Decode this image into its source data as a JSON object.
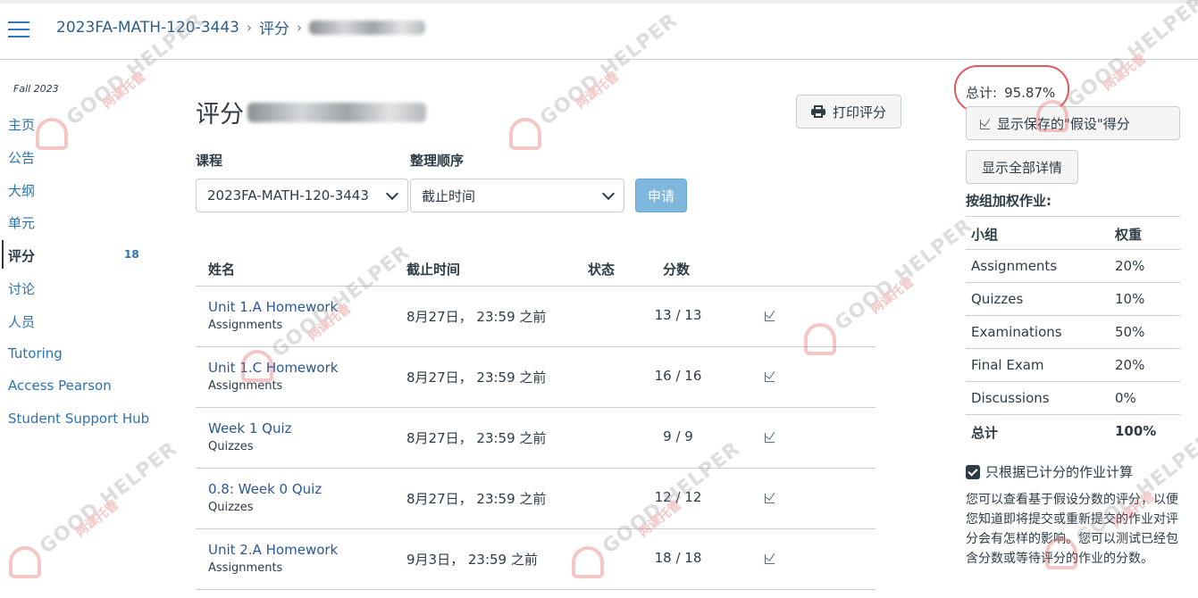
{
  "breadcrumb": {
    "course": "2023FA-MATH-120-3443",
    "grades": "评分",
    "separator": "›"
  },
  "nav": {
    "term": "Fall 2023",
    "items": [
      {
        "label": "主页"
      },
      {
        "label": "公告"
      },
      {
        "label": "大纲"
      },
      {
        "label": "单元"
      },
      {
        "label": "评分",
        "badge": "18",
        "active": true
      },
      {
        "label": "讨论"
      },
      {
        "label": "人员"
      },
      {
        "label": "Tutoring"
      },
      {
        "label": "Access Pearson"
      },
      {
        "label": "Student Support Hub"
      }
    ]
  },
  "main": {
    "title": "评分",
    "print_label": "打印评分",
    "course_label": "课程",
    "course_value": "2023FA-MATH-120-3443",
    "sort_label": "整理顺序",
    "sort_value": "截止时间",
    "apply_label": "申请",
    "columns": {
      "name": "姓名",
      "due": "截止时间",
      "status": "状态",
      "score": "分数"
    },
    "rows": [
      {
        "name": "Unit 1.A Homework",
        "group": "Assignments",
        "due": "8月27日， 23:59 之前",
        "score": "13 / 13"
      },
      {
        "name": "Unit 1.C Homework",
        "group": "Assignments",
        "due": "8月27日， 23:59 之前",
        "score": "16 / 16"
      },
      {
        "name": "Week 1 Quiz",
        "group": "Quizzes",
        "due": "8月27日， 23:59 之前",
        "score": "9 / 9"
      },
      {
        "name": "0.8: Week 0 Quiz",
        "group": "Quizzes",
        "due": "8月27日， 23:59 之前",
        "score": "12 / 12"
      },
      {
        "name": "Unit 2.A Homework",
        "group": "Assignments",
        "due": "9月3日， 23:59 之前",
        "score": "18 / 18"
      }
    ]
  },
  "side": {
    "total_label": "总计:",
    "total_value": "95.87%",
    "whatif_label": "显示保存的\"假设\"得分",
    "details_label": "显示全部详情",
    "weights_title": "按组加权作业:",
    "weights_header": {
      "group": "小组",
      "weight": "权重"
    },
    "weights": [
      {
        "group": "Assignments",
        "weight": "20%"
      },
      {
        "group": "Quizzes",
        "weight": "10%"
      },
      {
        "group": "Examinations",
        "weight": "50%"
      },
      {
        "group": "Final Exam",
        "weight": "20%"
      },
      {
        "group": "Discussions",
        "weight": "0%"
      }
    ],
    "weights_total": {
      "group": "总计",
      "weight": "100%"
    },
    "checkbox_label": "只根据已计分的作业计算",
    "hint": "您可以查看基于假设分数的评分，以便您知道即将提交或重新提交的作业对评分会有怎样的影响。您可以测试已经包含分数或等待评分的作业的分数。"
  },
  "watermark": {
    "text": "GOOD HELPER",
    "subtext": "网课托管"
  },
  "colors": {
    "link": "#2b72b6",
    "apply": "#7fb7dd",
    "annotation": "#e05a5a"
  }
}
